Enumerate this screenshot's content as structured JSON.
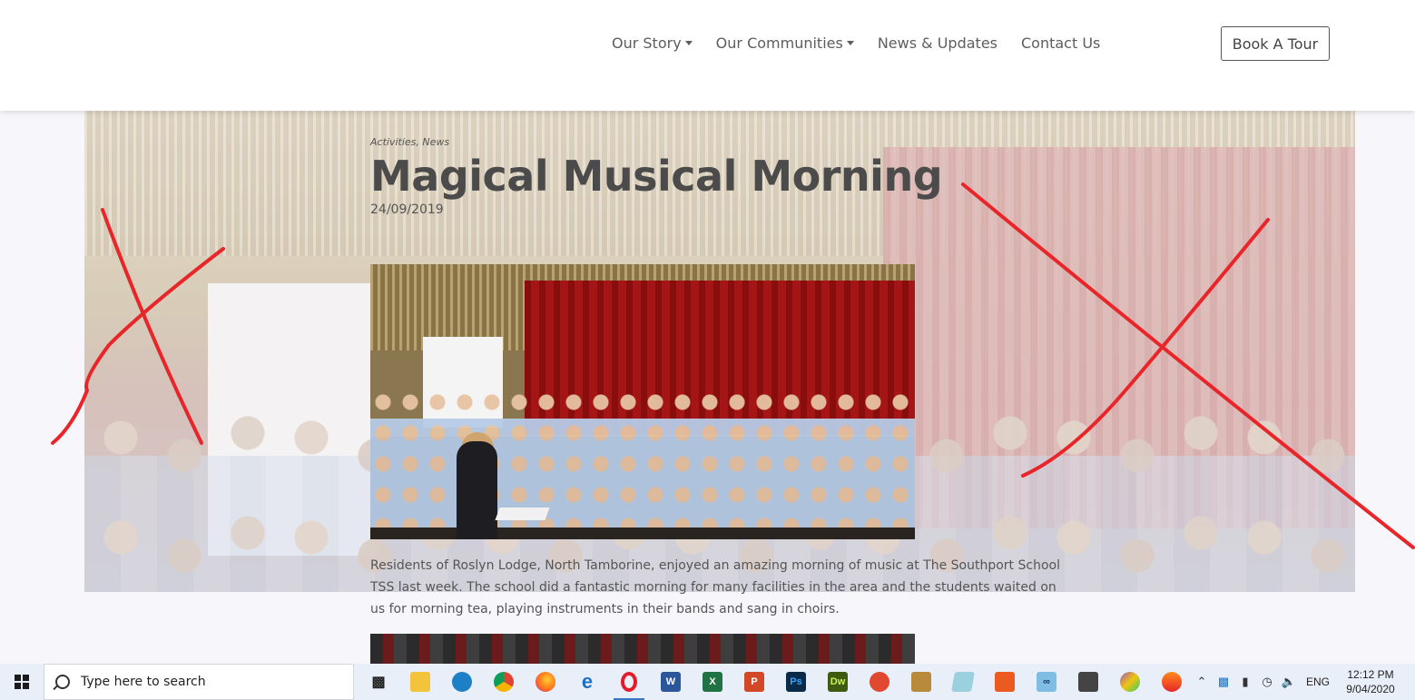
{
  "header": {
    "nav": [
      {
        "label": "Our Story",
        "dropdown": true
      },
      {
        "label": "Our Communities",
        "dropdown": true
      },
      {
        "label": "News & Updates",
        "dropdown": false
      },
      {
        "label": "Contact Us",
        "dropdown": false
      }
    ],
    "cta_label": "Book A Tour"
  },
  "article": {
    "categories": "Activities, News",
    "title": "Magical Musical Morning",
    "date": "24/09/2019",
    "body": "Residents of Roslyn Lodge, North Tamborine, enjoyed an amazing morning of music at The Southport School TSS last week. The school did a fantastic morning for many facilities in the area and the students waited on us for morning tea, playing instruments in their bands and sang in choirs."
  },
  "colors": {
    "scribble": "#e8262a",
    "accent": "#3a78c4"
  },
  "taskbar": {
    "search_placeholder": "Type here to search",
    "apps": [
      {
        "icon": "task-view-icon",
        "label": ""
      },
      {
        "icon": "file-explorer-icon",
        "label": ""
      },
      {
        "icon": "edge-chromium-icon",
        "label": ""
      },
      {
        "icon": "chrome-icon",
        "label": ""
      },
      {
        "icon": "firefox-icon",
        "label": ""
      },
      {
        "icon": "edge-legacy-icon",
        "label": ""
      },
      {
        "icon": "opera-icon",
        "label": ""
      },
      {
        "icon": "word-icon",
        "label": ""
      },
      {
        "icon": "excel-icon",
        "label": ""
      },
      {
        "icon": "powerpoint-icon",
        "label": ""
      },
      {
        "icon": "photoshop-icon",
        "label": "Ps"
      },
      {
        "icon": "dreamweaver-icon",
        "label": "Dw"
      },
      {
        "icon": "flask-icon",
        "label": ""
      },
      {
        "icon": "install-icon",
        "label": ""
      },
      {
        "icon": "notepad-icon",
        "label": ""
      },
      {
        "icon": "office-icon",
        "label": ""
      },
      {
        "icon": "infinity-icon",
        "label": ""
      },
      {
        "icon": "calculator-icon",
        "label": ""
      },
      {
        "icon": "paint-icon",
        "label": ""
      },
      {
        "icon": "audio-icon",
        "label": ""
      }
    ],
    "language": "ENG",
    "time": "12:12 PM",
    "date": "9/04/2020"
  }
}
